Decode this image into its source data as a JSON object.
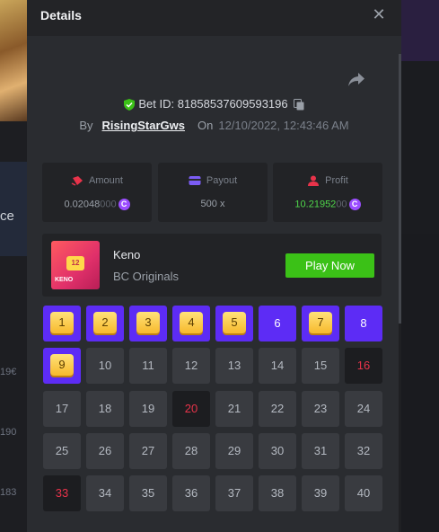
{
  "background": {
    "partial_label": "ce",
    "row_labels": [
      "19€",
      "190",
      "183"
    ]
  },
  "modal": {
    "title": "Details",
    "bet_id": "Bet ID: 818585376095931​96",
    "by_label": "By",
    "username": "RisingStarGws",
    "on_label": "On",
    "timestamp": "12/10/2022, 12:43:46 AM"
  },
  "stats": {
    "amount_label": "Amount",
    "amount_value": "0.02048",
    "amount_zeros": "000",
    "payout_label": "Payout",
    "payout_value": "500 x",
    "profit_label": "Profit",
    "profit_value": "10.21952",
    "profit_zeros": "00",
    "coin_symbol": "C"
  },
  "game": {
    "name": "Keno",
    "provider": "BC Originals",
    "thumb_number": "12",
    "thumb_label": "KENO",
    "play_label": "Play Now"
  },
  "board": {
    "cells": [
      {
        "n": "1",
        "state": "hit"
      },
      {
        "n": "2",
        "state": "hit"
      },
      {
        "n": "3",
        "state": "hit"
      },
      {
        "n": "4",
        "state": "hit"
      },
      {
        "n": "5",
        "state": "hit"
      },
      {
        "n": "6",
        "state": "picked"
      },
      {
        "n": "7",
        "state": "hit"
      },
      {
        "n": "8",
        "state": "picked"
      },
      {
        "n": "9",
        "state": "hit"
      },
      {
        "n": "10",
        "state": "none"
      },
      {
        "n": "11",
        "state": "none"
      },
      {
        "n": "12",
        "state": "none"
      },
      {
        "n": "13",
        "state": "none"
      },
      {
        "n": "14",
        "state": "none"
      },
      {
        "n": "15",
        "state": "none"
      },
      {
        "n": "16",
        "state": "drawn"
      },
      {
        "n": "17",
        "state": "none"
      },
      {
        "n": "18",
        "state": "none"
      },
      {
        "n": "19",
        "state": "none"
      },
      {
        "n": "20",
        "state": "drawn"
      },
      {
        "n": "21",
        "state": "none"
      },
      {
        "n": "22",
        "state": "none"
      },
      {
        "n": "23",
        "state": "none"
      },
      {
        "n": "24",
        "state": "none"
      },
      {
        "n": "25",
        "state": "none"
      },
      {
        "n": "26",
        "state": "none"
      },
      {
        "n": "27",
        "state": "none"
      },
      {
        "n": "28",
        "state": "none"
      },
      {
        "n": "29",
        "state": "none"
      },
      {
        "n": "30",
        "state": "none"
      },
      {
        "n": "31",
        "state": "none"
      },
      {
        "n": "32",
        "state": "none"
      },
      {
        "n": "33",
        "state": "drawn"
      },
      {
        "n": "34",
        "state": "none"
      },
      {
        "n": "35",
        "state": "none"
      },
      {
        "n": "36",
        "state": "none"
      },
      {
        "n": "37",
        "state": "none"
      },
      {
        "n": "38",
        "state": "none"
      },
      {
        "n": "39",
        "state": "none"
      },
      {
        "n": "40",
        "state": "none"
      }
    ]
  },
  "colors": {
    "picked": "#5d2cf5",
    "hit_gem": "#f7b92c",
    "drawn_text": "#e8334a",
    "play_button": "#3bc117",
    "profit_text": "#4fd64a"
  },
  "icons": {
    "close": "close-icon",
    "share": "share-icon",
    "verified": "shield-check-icon",
    "copy": "copy-icon",
    "amount": "bet-chip-icon",
    "payout": "wallet-icon",
    "profit": "profit-user-icon"
  }
}
